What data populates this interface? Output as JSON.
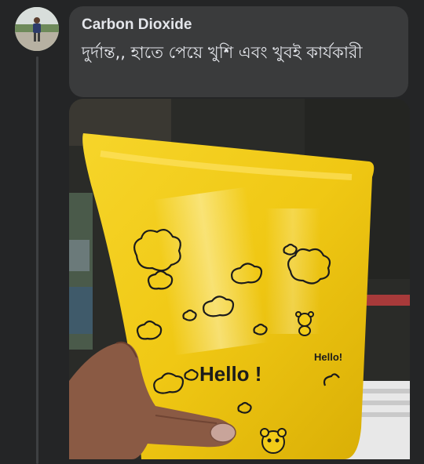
{
  "comment": {
    "author": "Carbon Dioxide",
    "text": "দুর্দান্ত,, হাতে পেয়ে খুশি এবং খুবই কার্যকারী"
  },
  "photo": {
    "subject": "yellow mailer bag",
    "printed_text_main": "Hello !",
    "printed_text_side": "Hello!",
    "colors": {
      "bag": "#f2cc18",
      "bag_shadow": "#d9ad00",
      "print": "#1b1b1b",
      "background": "#2c2d2a"
    }
  },
  "theme": {
    "page_bg": "#242526",
    "bubble_bg": "#3a3b3c",
    "text_color": "#e4e6eb"
  }
}
